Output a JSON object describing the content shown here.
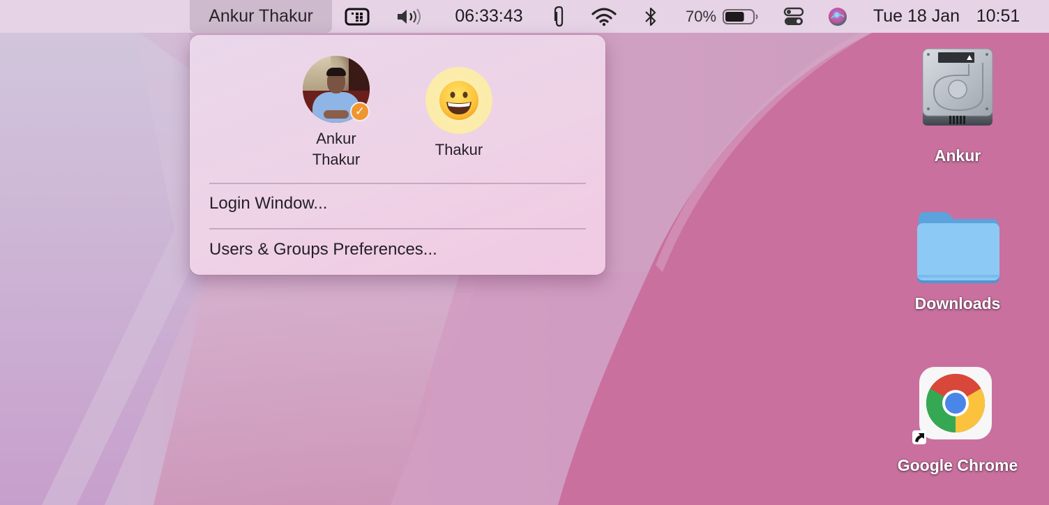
{
  "menubar": {
    "user_menu_label": "Ankur Thakur",
    "icons": [
      {
        "name": "input-source-icon"
      },
      {
        "name": "volume-icon"
      },
      {
        "name": "paperclip-icon"
      },
      {
        "name": "wifi-icon"
      },
      {
        "name": "bluetooth-icon"
      },
      {
        "name": "battery-icon"
      },
      {
        "name": "control-center-icon"
      },
      {
        "name": "siri-icon"
      }
    ],
    "timer": "06:33:43",
    "battery_percent": "70%",
    "battery_level": 0.7,
    "date": "Tue 18 Jan",
    "time": "10:51"
  },
  "user_dropdown": {
    "users": [
      {
        "name_line1": "Ankur",
        "name_line2": "Thakur",
        "avatar": "photo",
        "logged_in": true,
        "check_color": "#f0952f"
      },
      {
        "name_line1": "Thakur",
        "avatar": "grinning-face-emoji",
        "logged_in": false,
        "avatar_bg": "#fbe9a4"
      }
    ],
    "items": [
      {
        "label": "Login Window..."
      },
      {
        "label": "Users & Groups Preferences..."
      }
    ]
  },
  "desktop": {
    "icons": [
      {
        "label": "Ankur",
        "type": "hard-drive-icon"
      },
      {
        "label": "Downloads",
        "type": "folder-icon",
        "color": "#8ccaf5"
      },
      {
        "label": "Google Chrome",
        "type": "chrome-alias-icon"
      }
    ]
  },
  "colors": {
    "menubar_bg": "#e6d3e6",
    "wallpaper_pink": "#c96f9f",
    "wallpaper_lavender": "#cfa8cc"
  }
}
